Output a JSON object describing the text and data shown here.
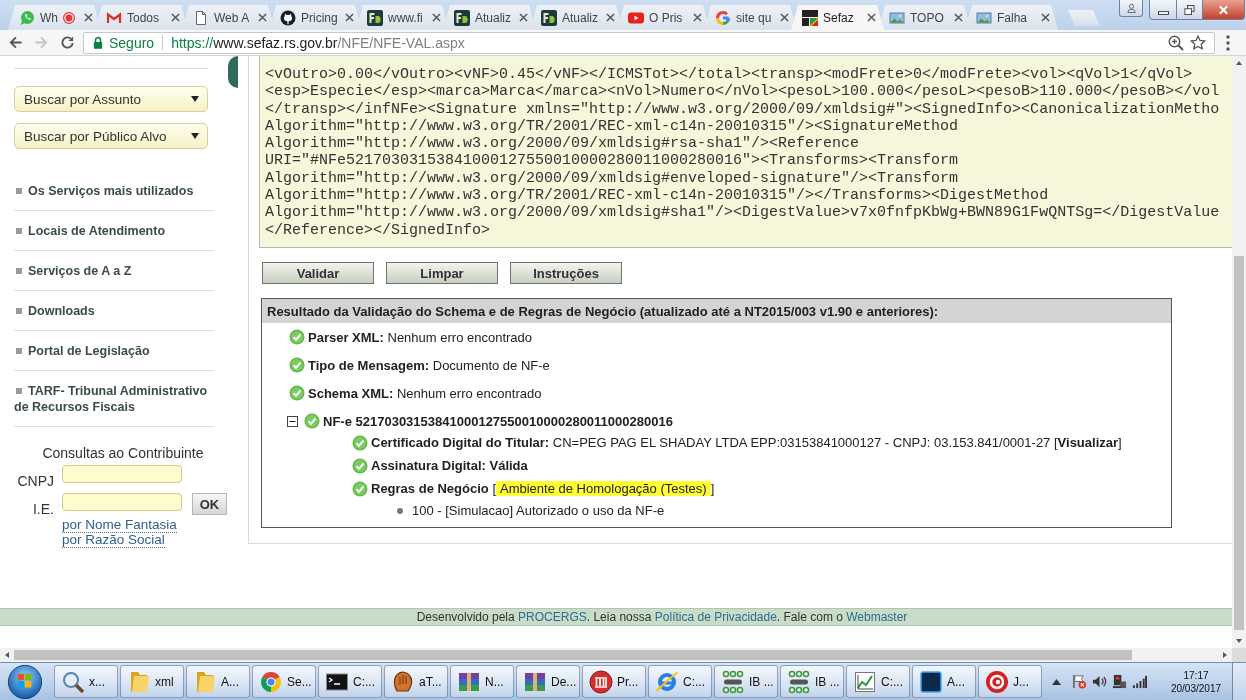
{
  "browser": {
    "tabs": [
      {
        "title": "Wh",
        "kind": "chat",
        "recording": true,
        "selected": false
      },
      {
        "title": "Todos",
        "kind": "mail",
        "recording": false,
        "selected": false
      },
      {
        "title": "Web A",
        "kind": "page",
        "recording": false,
        "selected": false
      },
      {
        "title": "Pricing",
        "kind": "cat",
        "recording": false,
        "selected": false
      },
      {
        "title": "www.fi",
        "kind": "tile",
        "recording": false,
        "selected": false
      },
      {
        "title": "Atualiz",
        "kind": "tile",
        "recording": false,
        "selected": false
      },
      {
        "title": "Atualiz",
        "kind": "tile",
        "recording": false,
        "selected": false
      },
      {
        "title": "O Pris",
        "kind": "video",
        "recording": false,
        "selected": false
      },
      {
        "title": "site qu",
        "kind": "ring",
        "recording": false,
        "selected": false
      },
      {
        "title": "Sefaz",
        "kind": "flag",
        "recording": false,
        "selected": true
      },
      {
        "title": "TOPO",
        "kind": "picture",
        "recording": false,
        "selected": false
      },
      {
        "title": "Falha",
        "kind": "picture",
        "recording": false,
        "selected": false
      }
    ],
    "nav": [
      {
        "kind": "back",
        "disabled": false
      },
      {
        "kind": "forward",
        "disabled": true
      },
      {
        "kind": "reload",
        "disabled": false
      }
    ],
    "address": {
      "security": "Seguro",
      "scheme": "https://",
      "host": "www.sefaz.rs.gov.br",
      "path": "/NFE/NFE-VAL.aspx"
    }
  },
  "sidebar": {
    "dropdowns": [
      {
        "value": "Buscar por Assunto"
      },
      {
        "value": "Buscar por Público Alvo"
      }
    ],
    "links": [
      "Os Serviços mais utilizados",
      "Locais de Atendimento",
      "Serviços de A a Z",
      "Downloads",
      "Portal de Legislação",
      "TARF- Tribunal Administrativo de Recursos Fiscais"
    ],
    "lookup": {
      "title": "Consultas ao Contribuinte",
      "fields": [
        {
          "label": "CNPJ"
        },
        {
          "label": "I.E."
        }
      ],
      "button": "OK",
      "links": [
        "por Nome Fantasia",
        "por Razão Social"
      ]
    }
  },
  "validator": {
    "xml_lines": [
      "<vOutro>0.00</vOutro><vNF>0.45</vNF></ICMSTot></total><transp><modFrete>0</modFrete><vol><qVol>1</qVol>",
      "<esp>Especie</esp><marca>Marca</marca><nVol>Numero</nVol><pesoL>100.000</pesoL><pesoB>110.000</pesoB></vol",
      "</transp></infNFe><Signature xmlns=\"http://www.w3.org/2000/09/xmldsig#\"><SignedInfo><CanonicalizationMetho",
      "Algorithm=\"http://www.w3.org/TR/2001/REC-xml-c14n-20010315\"/><SignatureMethod",
      "Algorithm=\"http://www.w3.org/2000/09/xmldsig#rsa-sha1\"/><Reference",
      "URI=\"#NFe52170303153841000127550010000280011000280016\"><Transforms><Transform",
      "Algorithm=\"http://www.w3.org/2000/09/xmldsig#enveloped-signature\"/><Transform",
      "Algorithm=\"http://www.w3.org/TR/2001/REC-xml-c14n-20010315\"/></Transforms><DigestMethod",
      "Algorithm=\"http://www.w3.org/2000/09/xmldsig#sha1\"/><DigestValue>v7x0fnfpKbWg+BWN89G1FwQNTSg=</DigestValue",
      "</Reference></SignedInfo>"
    ],
    "buttons": [
      "Validar",
      "Limpar",
      "Instruções"
    ],
    "result": {
      "title": "Resultado da Validação do Schema e de Regras de Negócio (atualizado até a NT2015/003 v1.90 e anteriores):",
      "items": [
        {
          "kind": "check",
          "passed": true,
          "label": "Parser XML:",
          "value": "Nenhum erro encontrado"
        },
        {
          "kind": "check",
          "passed": true,
          "label": "Tipo de Mensagem:",
          "value": "Documento de NF-e"
        },
        {
          "kind": "check",
          "passed": true,
          "label": "Schema XML:",
          "value": "Nenhum erro encontrado"
        },
        {
          "kind": "check",
          "passed": true,
          "label": "NF-e 52170303153841000127550010000280011000280016",
          "expanded": true,
          "children": [
            {
              "kind": "check",
              "passed": true,
              "label": "Certificado Digital do Titular:",
              "value": "CN=PEG PAG EL SHADAY LTDA EPP:03153841000127 - CNPJ: 03.153.841/0001-27 [**Visualizar**]"
            },
            {
              "kind": "check",
              "passed": true,
              "label": "Assinatura Digital:",
              "value": "**Válida**"
            },
            {
              "kind": "check",
              "passed": true,
              "label": "Regras de Negócio",
              "prefix": "[",
              "highlight": "Ambiente de Homologação (Testes)",
              "suffix": "]",
              "children": [
                {
                  "kind": "message",
                  "text": "100 - [Simulacao] Autorizado o uso da NF-e"
                }
              ]
            }
          ]
        }
      ]
    }
  },
  "footer": {
    "parts": [
      {
        "text": "Desenvolvido pela ",
        "link": false
      },
      {
        "text": "PROCERGS",
        "link": true
      },
      {
        "text": ". Leia nossa ",
        "link": false
      },
      {
        "text": "Política de Privacidade",
        "link": true
      },
      {
        "text": ". Fale com o ",
        "link": false
      },
      {
        "text": "Webmaster",
        "link": true
      }
    ]
  },
  "taskbar": {
    "items": [
      {
        "label": "x...",
        "kind": "magnifier"
      },
      {
        "label": "xml",
        "kind": "folder"
      },
      {
        "label": "A...",
        "kind": "folder"
      },
      {
        "label": "Se...",
        "kind": "ball"
      },
      {
        "label": "C:...",
        "kind": "terminal"
      },
      {
        "label": "aT...",
        "kind": "glove"
      },
      {
        "label": "N...",
        "kind": "books"
      },
      {
        "label": "De...",
        "kind": "books"
      },
      {
        "label": "Pr...",
        "kind": "emblem"
      },
      {
        "label": "C:...",
        "kind": "ring"
      },
      {
        "label": "IB ...",
        "kind": "dots"
      },
      {
        "label": "IB ...",
        "kind": "dots"
      },
      {
        "label": "C:...",
        "kind": "chart"
      },
      {
        "label": "A...",
        "kind": "square"
      },
      {
        "label": "J...",
        "kind": "swirl"
      }
    ],
    "clock": {
      "time": "17:17",
      "date": "20/03/2017"
    }
  }
}
